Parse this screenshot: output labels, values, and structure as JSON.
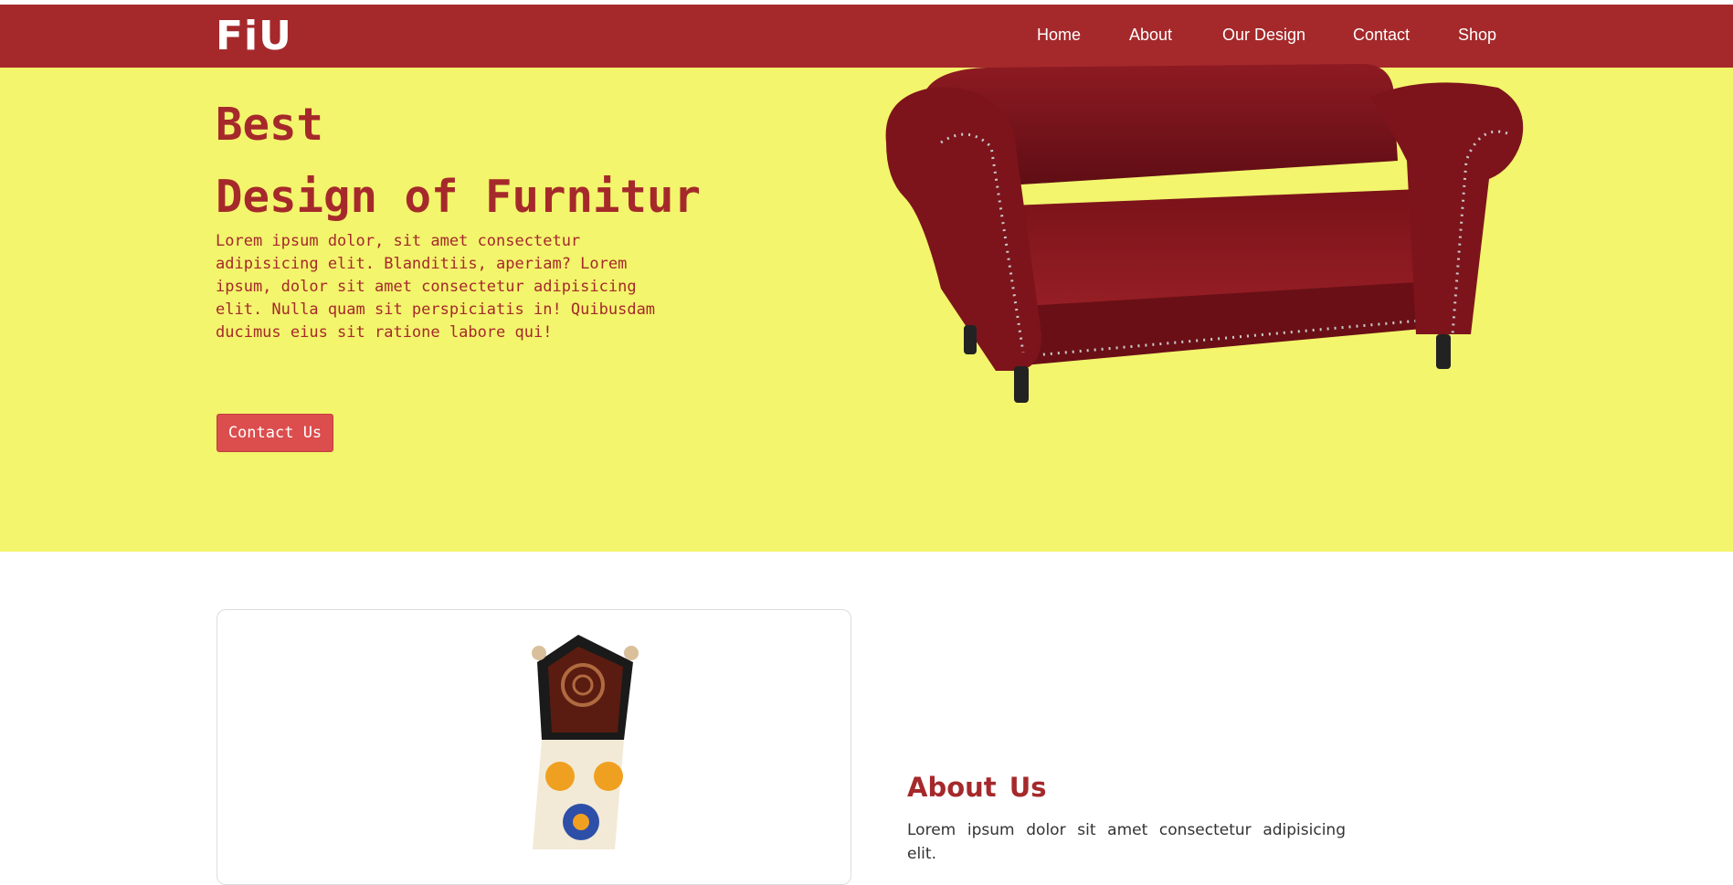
{
  "brand": {
    "logo_text": "FiU"
  },
  "nav": {
    "items": [
      {
        "label": "Home"
      },
      {
        "label": "About"
      },
      {
        "label": "Our Design"
      },
      {
        "label": "Contact"
      },
      {
        "label": "Shop"
      }
    ]
  },
  "hero": {
    "title_line1": "Best",
    "title_line2": "Design of Furnitur",
    "description": "Lorem ipsum dolor, sit amet consectetur adipisicing elit. Blanditiis, aperiam? Lorem ipsum, dolor sit amet consectetur adipisicing elit. Nulla quam sit perspiciatis in! Quibusdam ducimus eius sit ratione labore qui!",
    "button_label": "Contact Us",
    "image_icon": "red-sofa-image"
  },
  "about": {
    "title": "About Us",
    "text": "Lorem ipsum dolor sit amet consectetur adipisicing elit.",
    "image_icon": "decorative-chair-image"
  },
  "colors": {
    "brand_red": "#a5292b",
    "hero_yellow": "#f3f56c",
    "button_red": "#dc4d4d"
  }
}
